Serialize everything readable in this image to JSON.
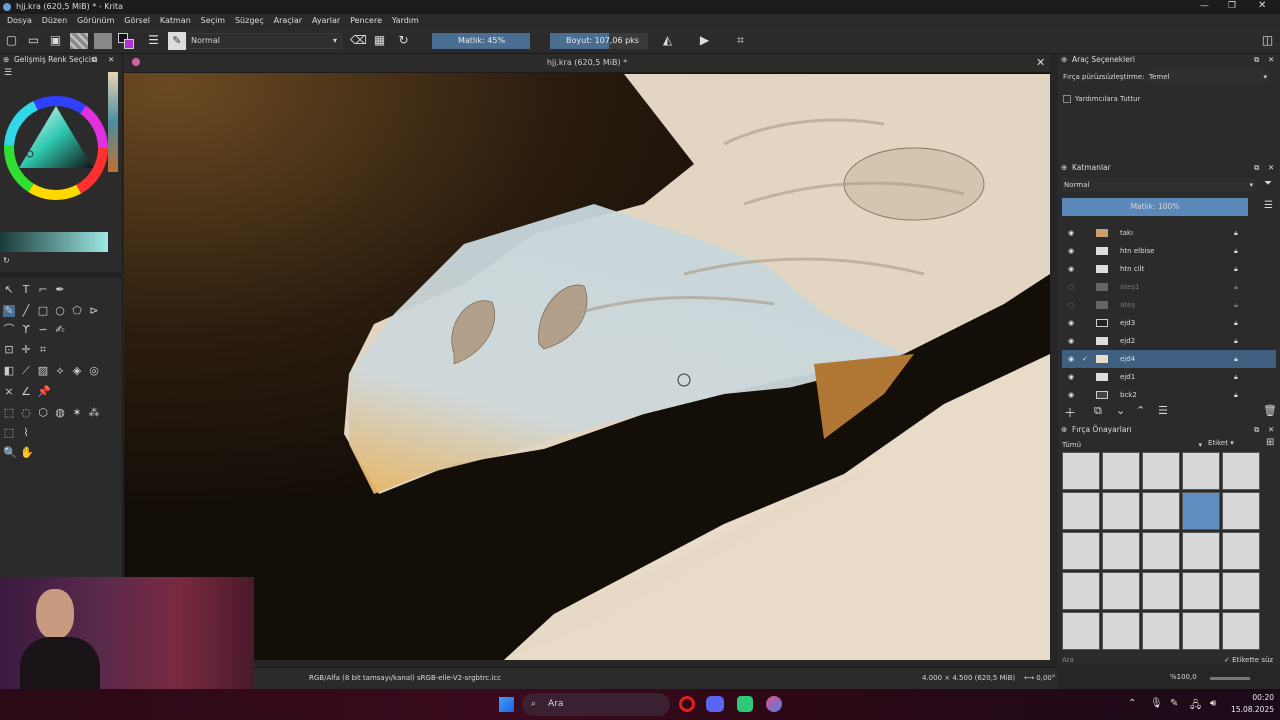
{
  "window": {
    "title": "hjj.kra (620,5 MiB) * - Krita"
  },
  "menu": [
    "Dosya",
    "Düzen",
    "Görünüm",
    "Görsel",
    "Katman",
    "Seçim",
    "Süzgeç",
    "Araçlar",
    "Ayarlar",
    "Pencere",
    "Yardım"
  ],
  "toolbar": {
    "blend_mode": "Normal",
    "opacity": "Matlık: 45%",
    "size": "Boyut: 107,06 pks"
  },
  "left_panel": {
    "title": "Gelişmiş Renk Seçicisi"
  },
  "document": {
    "tab_title": "hjj.kra (620,5 MiB) *"
  },
  "tool_options": {
    "title": "Araç Seçenekleri",
    "smoothing_label": "Fırça pürüzsüzleştirme:",
    "smoothing_value": "Temel",
    "assistants_label": "Yardımcılara Tuttur"
  },
  "layers": {
    "title": "Katmanlar",
    "blend_mode": "Normal",
    "opacity": "Matlık: 100%",
    "items": [
      {
        "name": "takı",
        "visible": true
      },
      {
        "name": "htn elbise",
        "visible": true
      },
      {
        "name": "htn cilt",
        "visible": true
      },
      {
        "name": "ateş1",
        "visible": false
      },
      {
        "name": "ateş",
        "visible": false
      },
      {
        "name": "ejd3",
        "visible": true
      },
      {
        "name": "ejd2",
        "visible": true
      },
      {
        "name": "ejd4",
        "visible": true,
        "selected": true
      },
      {
        "name": "ejd1",
        "visible": true
      },
      {
        "name": "bck2",
        "visible": true
      }
    ]
  },
  "brush_presets": {
    "title": "Fırça Önayarları",
    "filter": "Tümü",
    "tag_label": "Etiket",
    "search_placeholder": "Ara",
    "tag_search_label": "Etikette süz"
  },
  "status": {
    "color_space": "RGB/Alfa (8 bit tamsayı/kanal) sRGB-elle-V2-srgbtrc.icc",
    "dimensions": "4.000 × 4.500 (620,5 MiB)",
    "rotation": "0,00°",
    "zoom": "%100,0"
  },
  "taskbar": {
    "search_label": "Ara",
    "time": "00:20",
    "date": "15.08.2025"
  }
}
